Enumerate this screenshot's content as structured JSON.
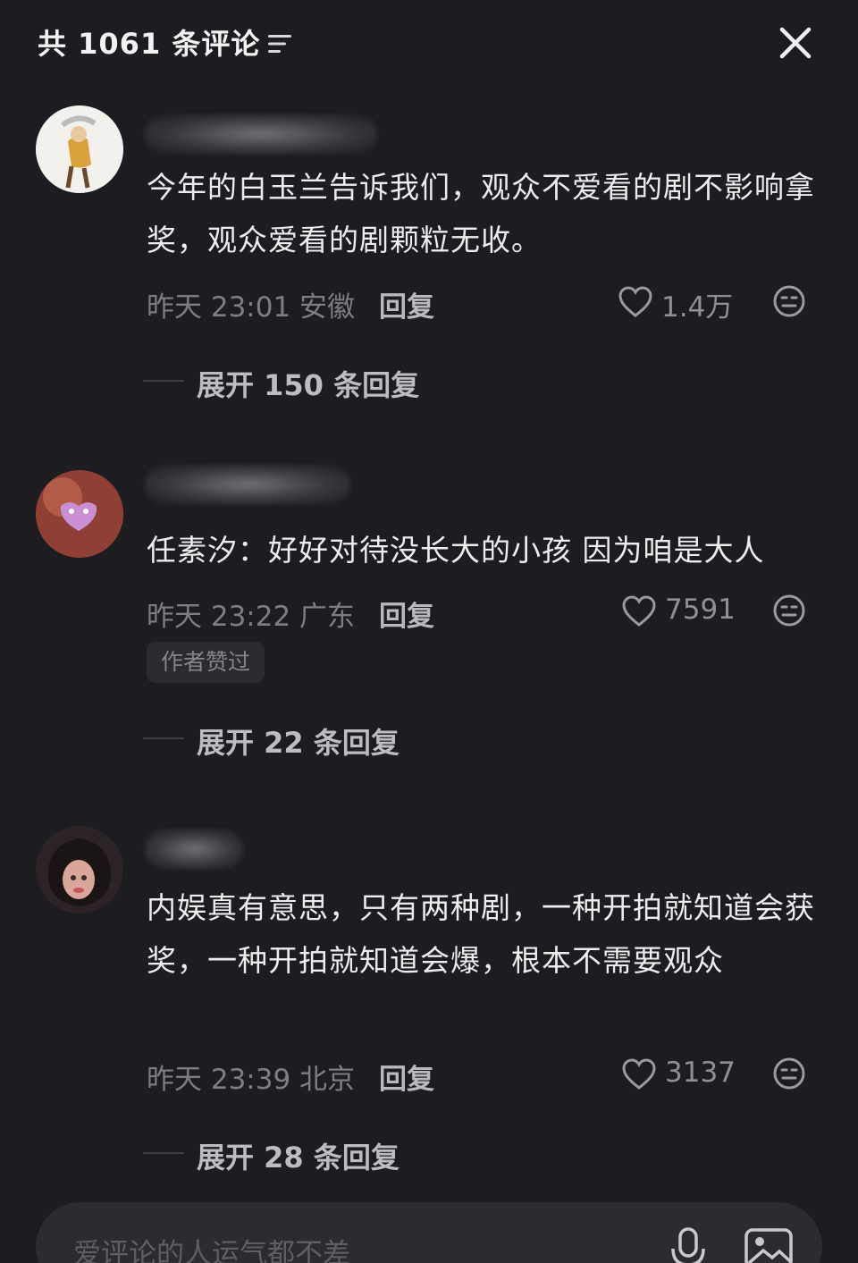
{
  "header": {
    "title": "共 1061 条评论",
    "filter_icon": "filter-icon",
    "close_icon": "close-icon"
  },
  "comments": [
    {
      "text": "今年的白玉兰告诉我们，观众不爱看的剧不影响拿奖，观众爱看的剧颗粒无收。",
      "time_location": "昨天 23:01 安徽",
      "reply_label": "回复",
      "likes": "1.4万",
      "expand_label": "展开 150 条回复"
    },
    {
      "text": "任素汐：好好对待没长大的小孩 因为咱是大人",
      "time_location": "昨天 23:22 广东",
      "reply_label": "回复",
      "likes": "7591",
      "badge": "作者赞过",
      "expand_label": "展开 22 条回复"
    },
    {
      "text": "内娱真有意思，只有两种剧，一种开拍就知道会获奖，一种开拍就知道会爆，根本不需要观众",
      "time_location": "昨天 23:39 北京",
      "reply_label": "回复",
      "likes": "3137",
      "expand_label": "展开 28 条回复"
    }
  ],
  "input": {
    "placeholder": "爱评论的人运气都不差",
    "mic_icon": "microphone-icon",
    "image_icon": "image-icon"
  },
  "colors": {
    "background": "#1c1c21",
    "text": "#ededee",
    "muted": "#7d7d82",
    "input_bg": "#2b2b30"
  }
}
